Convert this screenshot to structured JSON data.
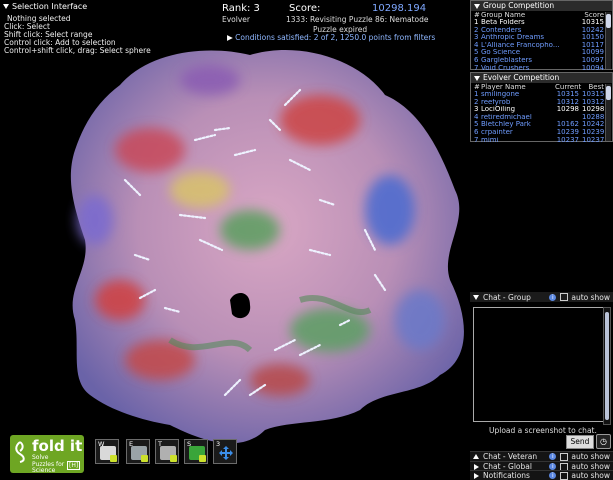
{
  "selection_panel": {
    "title": "Selection Interface",
    "lines": [
      "Nothing selected",
      "Click: Select",
      "Shift click: Select range",
      "Control click: Add to selection",
      "Control+shift click, drag: Select sphere"
    ]
  },
  "score_header": {
    "rank_label": "Rank: 3",
    "score_label": "Score:",
    "score_value": "10298.194",
    "evolver_label": "Evolver",
    "puzzle_title": "1333: Revisiting Puzzle 86: Nematode",
    "puzzle_status": "Puzzle expired",
    "conditions": "Conditions satisfied: 2 of 2, 1250.0 points from filters"
  },
  "group_competition": {
    "title": "Group Competition",
    "columns": {
      "num": "#",
      "name": "Group Name",
      "score": "Score"
    },
    "rows": [
      {
        "rank": "1",
        "name": "Beta Folders",
        "score": "10315",
        "highlight": true
      },
      {
        "rank": "2",
        "name": "Contenders",
        "score": "10242"
      },
      {
        "rank": "3",
        "name": "Anthropic Dreams",
        "score": "10150"
      },
      {
        "rank": "4",
        "name": "L'Alliance Francopho...",
        "score": "10117"
      },
      {
        "rank": "5",
        "name": "Go Science",
        "score": "10099"
      },
      {
        "rank": "6",
        "name": "Gargleblasters",
        "score": "10097"
      },
      {
        "rank": "7",
        "name": "Void Crushers",
        "score": "10094"
      }
    ]
  },
  "evolver_competition": {
    "title": "Evolver Competition",
    "columns": {
      "num": "#",
      "name": "Player Name",
      "current": "Current",
      "best": "Best"
    },
    "rows": [
      {
        "rank": "1",
        "name": "smilingone",
        "current": "10315",
        "best": "10315"
      },
      {
        "rank": "2",
        "name": "reefyrob",
        "current": "10312",
        "best": "10312"
      },
      {
        "rank": "3",
        "name": "LociOiling",
        "current": "10298",
        "best": "10298",
        "highlight": true
      },
      {
        "rank": "4",
        "name": "retiredmichael",
        "current": "",
        "best": "10288"
      },
      {
        "rank": "5",
        "name": "Bletchley Park",
        "current": "10162",
        "best": "10242"
      },
      {
        "rank": "6",
        "name": "crpainter",
        "current": "10239",
        "best": "10239"
      },
      {
        "rank": "7",
        "name": "mimi",
        "current": "10237",
        "best": "10237"
      }
    ]
  },
  "chat": {
    "group_label": "Chat - Group",
    "auto_show": "auto show",
    "screenshot_hint": "Upload a screenshot to chat.",
    "send_label": "Send",
    "veteran_label": "Chat - Veteran",
    "global_label": "Chat - Global",
    "notifications_label": "Notifications"
  },
  "logo": {
    "name": "fold it",
    "tagline": "Solve Puzzles for Science",
    "beta": "[H]"
  },
  "tools": [
    {
      "key": "W",
      "icon": "wiggle-icon",
      "color": "#d9d9d9"
    },
    {
      "key": "E",
      "icon": "backbone-icon",
      "color": "#9aa3a8"
    },
    {
      "key": "T",
      "icon": "structure-icon",
      "color": "#b0b0b0"
    },
    {
      "key": "S",
      "icon": "shake-icon",
      "color": "#3aa53a"
    },
    {
      "key": "3",
      "icon": "move-icon",
      "color": "#3b8ee8"
    }
  ],
  "colors": {
    "accent_blue": "#8fb7ff",
    "score_blue": "#7fa8ff",
    "logo_green": "#6ea623"
  }
}
